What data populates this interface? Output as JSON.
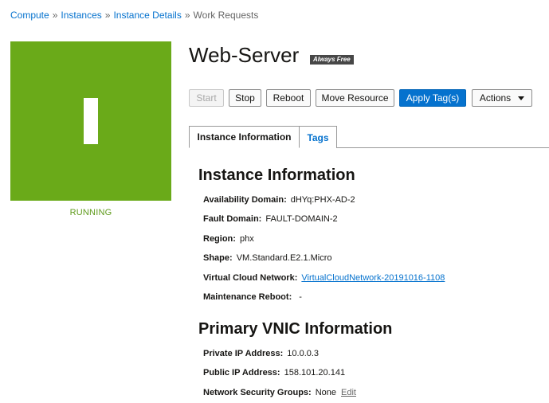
{
  "breadcrumb": {
    "items": [
      "Compute",
      "Instances",
      "Instance Details"
    ],
    "separator": "»",
    "current": "Work Requests"
  },
  "instance": {
    "name": "Web-Server",
    "badge": "Always Free",
    "status": "RUNNING",
    "status_color": "#6aaa19"
  },
  "toolbar": {
    "start": "Start",
    "stop": "Stop",
    "reboot": "Reboot",
    "move_resource": "Move Resource",
    "apply_tags": "Apply Tag(s)",
    "actions": "Actions"
  },
  "tabs": [
    {
      "label": "Instance Information",
      "active": true
    },
    {
      "label": "Tags",
      "active": false
    }
  ],
  "instance_info": {
    "title": "Instance Information",
    "fields": [
      {
        "label": "Availability Domain:",
        "value": "dHYq:PHX-AD-2"
      },
      {
        "label": "Fault Domain:",
        "value": "FAULT-DOMAIN-2"
      },
      {
        "label": "Region:",
        "value": "phx"
      },
      {
        "label": "Shape:",
        "value": "VM.Standard.E2.1.Micro"
      },
      {
        "label": "Virtual Cloud Network:",
        "value": "VirtualCloudNetwork-20191016-1108"
      },
      {
        "label": "Maintenance Reboot:",
        "value": "-"
      }
    ]
  },
  "vnic_info": {
    "title": "Primary VNIC Information",
    "fields": [
      {
        "label": "Private IP Address:",
        "value": "10.0.0.3"
      },
      {
        "label": "Public IP Address:",
        "value": "158.101.20.141"
      },
      {
        "label": "Network Security Groups:",
        "value": "None",
        "action": "Edit"
      }
    ]
  },
  "colors": {
    "accent": "#0572ce",
    "running": "#6aaa19"
  }
}
